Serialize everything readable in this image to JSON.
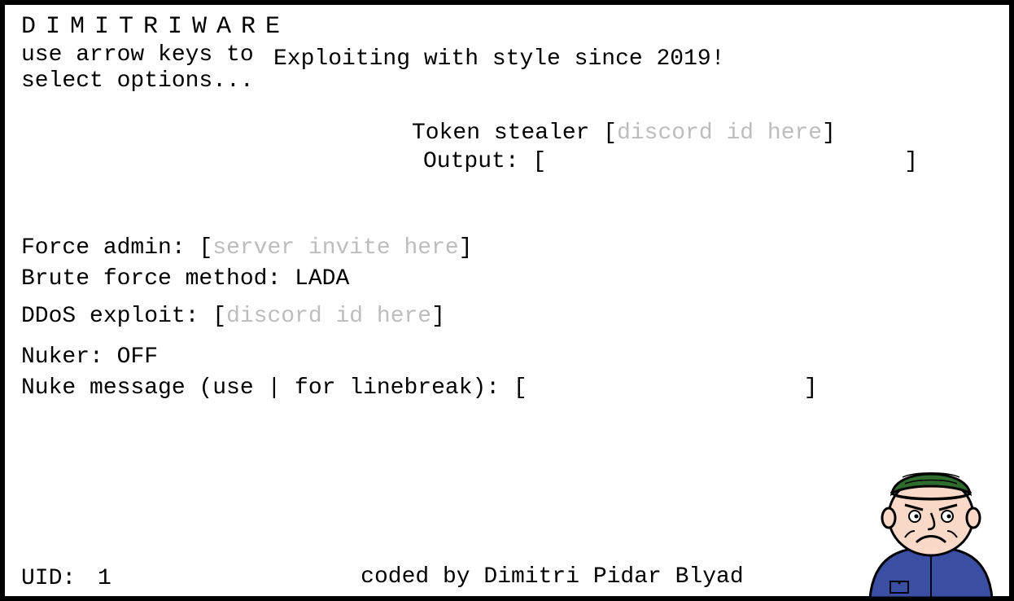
{
  "title": "DIMITRIWARE",
  "subtitle": "use arrow keys to select options...",
  "tagline": "Exploiting with style since 2019!",
  "token": {
    "label": "Token stealer",
    "placeholder": "discord id here",
    "output_label": "Output:",
    "output_value": ""
  },
  "force_admin": {
    "label": "Force admin:",
    "placeholder": "server invite here"
  },
  "brute": {
    "label": "Brute force method:",
    "value": "LADA"
  },
  "ddos": {
    "label": "DDoS exploit:",
    "placeholder": "discord id here"
  },
  "nuker": {
    "label": "Nuker:",
    "value": "OFF"
  },
  "nuke_msg": {
    "label": "Nuke message (use | for linebreak):",
    "value": ""
  },
  "uid": {
    "label": "UID:",
    "value": "1"
  },
  "credit": "coded by Dimitri Pidar Blyad"
}
